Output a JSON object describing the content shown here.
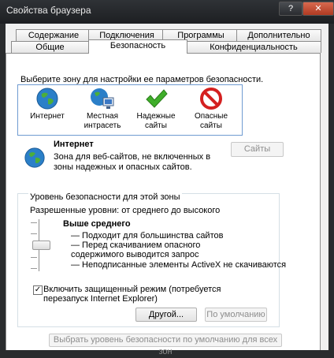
{
  "window": {
    "title": "Свойства браузера",
    "help_label": "?",
    "close_label": "✕"
  },
  "tabs_row1": [
    "Содержание",
    "Подключения",
    "Программы",
    "Дополнительно"
  ],
  "tabs_row2": [
    "Общие",
    "Безопасность",
    "Конфиденциальность"
  ],
  "zones": {
    "prompt": "Выберите зону для настройки ее параметров безопасности.",
    "items": [
      {
        "label": "Интернет",
        "icon": "globe-icon"
      },
      {
        "label": "Местная интрасеть",
        "icon": "intranet-icon"
      },
      {
        "label": "Надежные сайты",
        "icon": "checkmark-icon"
      },
      {
        "label": "Опасные сайты",
        "icon": "prohibited-icon"
      }
    ]
  },
  "selected_zone": {
    "title": "Интернет",
    "description": "Зона для веб-сайтов, не включенных в зоны надежных и опасных сайтов.",
    "sites_button": "Сайты"
  },
  "security_level": {
    "group_label": "Уровень безопасности для этой зоны",
    "allowed": "Разрешенные уровни: от среднего до высокого",
    "level_title": "Выше среднего",
    "bullets": [
      "— Подходит для большинства сайтов",
      "— Перед скачиванием опасного содержимого выводится запрос",
      "— Неподписанные элементы ActiveX не скачиваются"
    ],
    "protected_mode_label": "Включить защищенный режим (потребуется перезапуск Internet Explorer)",
    "protected_mode_checked": true,
    "custom_button": "Другой...",
    "default_button": "По умолчанию"
  },
  "reset_all_button": "Выбрать уровень безопасности по умолчанию для всех зон"
}
